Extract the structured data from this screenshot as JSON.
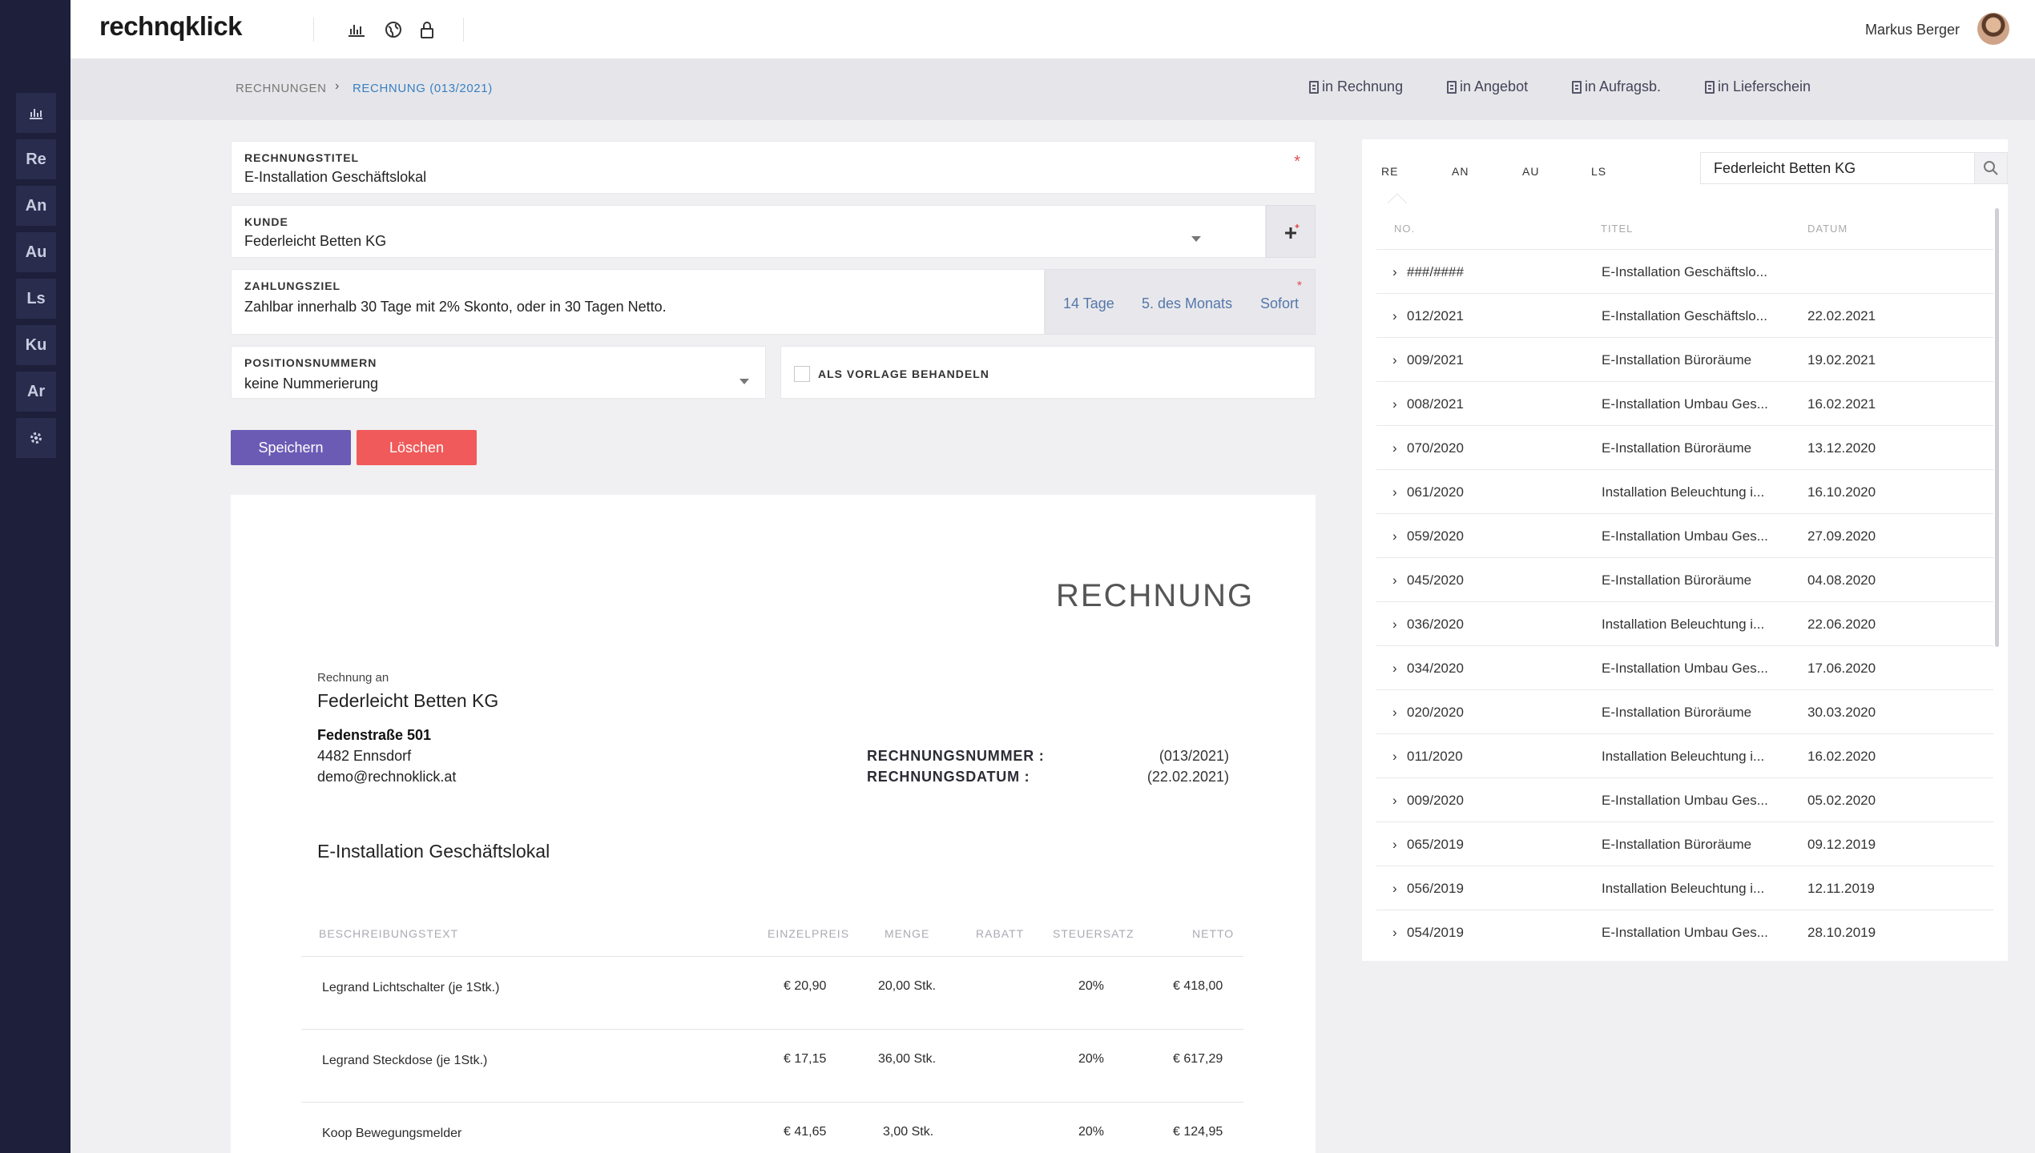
{
  "app": {
    "logo": "rechnqklick",
    "user_name": "Markus Berger"
  },
  "sidebar": {
    "items": [
      {
        "label": "",
        "icon": "chart-icon"
      },
      {
        "label": "Re"
      },
      {
        "label": "An"
      },
      {
        "label": "Au"
      },
      {
        "label": "Ls"
      },
      {
        "label": "Ku"
      },
      {
        "label": "Ar"
      },
      {
        "label": "",
        "icon": "gear-icon"
      }
    ]
  },
  "topbar": {
    "icons": [
      "chart-icon",
      "globe-icon",
      "lock-icon"
    ]
  },
  "breadcrumb": {
    "parent": "RECHNUNGEN",
    "current": "RECHNUNG (013/2021)"
  },
  "convert_actions": [
    "in Rechnung",
    "in Angebot",
    "in Aufragsb.",
    "in Lieferschein"
  ],
  "form": {
    "title_label": "RECHNUNGSTITEL",
    "title_value": "E-Installation Geschäftslokal",
    "customer_label": "KUNDE",
    "customer_value": "Federleicht Betten KG",
    "payment_label": "ZAHLUNGSZIEL",
    "payment_value": "Zahlbar innerhalb 30 Tage mit 2% Skonto, oder in 30 Tagen Netto.",
    "payment_options": [
      "14 Tage",
      "5. des Monats",
      "Sofort"
    ],
    "position_label": "POSITIONSNUMMERN",
    "position_value": "keine Nummerierung",
    "template_label": "ALS VORLAGE BEHANDELN",
    "save_label": "Speichern",
    "delete_label": "Löschen"
  },
  "document": {
    "heading": "RECHNUNG",
    "to_label": "Rechnung an",
    "customer_name": "Federleicht Betten KG",
    "street": "Fedenstraße 501",
    "city": "4482 Ennsdorf",
    "email": "demo@rechnoklick.at",
    "number_label": "RECHNUNGSNUMMER :",
    "number_value": "(013/2021)",
    "date_label": "RECHNUNGSDATUM :",
    "date_value": "(22.02.2021)",
    "subject": "E-Installation Geschäftslokal",
    "columns": [
      "BESCHREIBUNGSTEXT",
      "EINZELPREIS",
      "MENGE",
      "RABATT",
      "STEUERSATZ",
      "NETTO"
    ],
    "rows": [
      {
        "desc": "Legrand Lichtschalter (je 1Stk.)",
        "price": "€ 20,90",
        "qty": "20,00 Stk.",
        "discount": "",
        "tax": "20%",
        "net": "€ 418,00"
      },
      {
        "desc": "Legrand Steckdose (je 1Stk.)",
        "price": "€ 17,15",
        "qty": "36,00 Stk.",
        "discount": "",
        "tax": "20%",
        "net": "€ 617,29"
      },
      {
        "desc": "Koop Bewegungsmelder",
        "price": "€ 41,65",
        "qty": "3,00 Stk.",
        "discount": "",
        "tax": "20%",
        "net": "€ 124,95"
      }
    ]
  },
  "right_panel": {
    "tabs": [
      "RE",
      "AN",
      "AU",
      "LS"
    ],
    "search_value": "Federleicht Betten KG",
    "columns": [
      "NO.",
      "TITEL",
      "DATUM"
    ],
    "rows": [
      {
        "no": "###/####",
        "title": "E-Installation Geschäftslo...",
        "date": ""
      },
      {
        "no": "012/2021",
        "title": "E-Installation Geschäftslo...",
        "date": "22.02.2021"
      },
      {
        "no": "009/2021",
        "title": "E-Installation Büroräume",
        "date": "19.02.2021"
      },
      {
        "no": "008/2021",
        "title": "E-Installation Umbau Ges...",
        "date": "16.02.2021"
      },
      {
        "no": "070/2020",
        "title": "E-Installation Büroräume",
        "date": "13.12.2020"
      },
      {
        "no": "061/2020",
        "title": "Installation Beleuchtung i...",
        "date": "16.10.2020"
      },
      {
        "no": "059/2020",
        "title": "E-Installation Umbau Ges...",
        "date": "27.09.2020"
      },
      {
        "no": "045/2020",
        "title": "E-Installation Büroräume",
        "date": "04.08.2020"
      },
      {
        "no": "036/2020",
        "title": "Installation Beleuchtung i...",
        "date": "22.06.2020"
      },
      {
        "no": "034/2020",
        "title": "E-Installation Umbau Ges...",
        "date": "17.06.2020"
      },
      {
        "no": "020/2020",
        "title": "E-Installation Büroräume",
        "date": "30.03.2020"
      },
      {
        "no": "011/2020",
        "title": "Installation Beleuchtung i...",
        "date": "16.02.2020"
      },
      {
        "no": "009/2020",
        "title": "E-Installation Umbau Ges...",
        "date": "05.02.2020"
      },
      {
        "no": "065/2019",
        "title": "E-Installation Büroräume",
        "date": "09.12.2019"
      },
      {
        "no": "056/2019",
        "title": "Installation Beleuchtung i...",
        "date": "12.11.2019"
      },
      {
        "no": "054/2019",
        "title": "E-Installation Umbau Ges...",
        "date": "28.10.2019"
      }
    ]
  },
  "colors": {
    "sidebar": "#1d1f3b",
    "accent": "#6c5bb5",
    "danger": "#f05a5a",
    "link": "#3a7fc2"
  }
}
